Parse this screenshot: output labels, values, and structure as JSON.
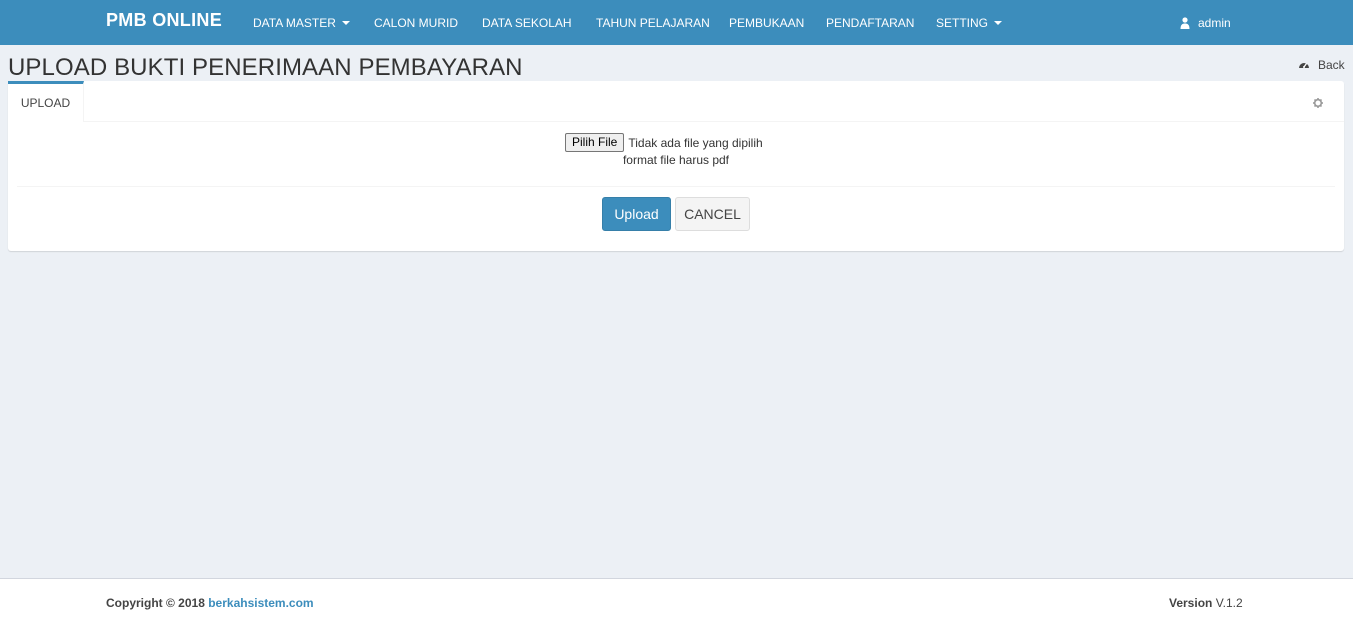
{
  "navbar": {
    "brand": "PMB ONLINE",
    "items": [
      {
        "label": "DATA MASTER",
        "dropdown": true
      },
      {
        "label": "CALON MURID",
        "dropdown": false
      },
      {
        "label": "DATA SEKOLAH",
        "dropdown": false
      },
      {
        "label": "TAHUN PELAJARAN",
        "dropdown": false
      },
      {
        "label": "PEMBUKAAN",
        "dropdown": false
      },
      {
        "label": "PENDAFTARAN",
        "dropdown": false
      },
      {
        "label": "SETTING",
        "dropdown": true
      }
    ],
    "user": "admin"
  },
  "header": {
    "title": "UPLOAD BUKTI PENERIMAAN PEMBAYARAN",
    "back_label": "Back"
  },
  "panel": {
    "tab_label": "UPLOAD",
    "file_button": "Pilih File",
    "file_status": "Tidak ada file yang dipilih",
    "help_text": "format file harus pdf",
    "upload_label": "Upload",
    "cancel_label": "CANCEL"
  },
  "footer": {
    "copyright_prefix": "Copyright © 2018",
    "copyright_link": "berkahsistem.com",
    "version_label": "Version",
    "version_value": "V.1.2"
  },
  "colors": {
    "primary": "#3c8dbc",
    "background": "#ecf0f5"
  }
}
